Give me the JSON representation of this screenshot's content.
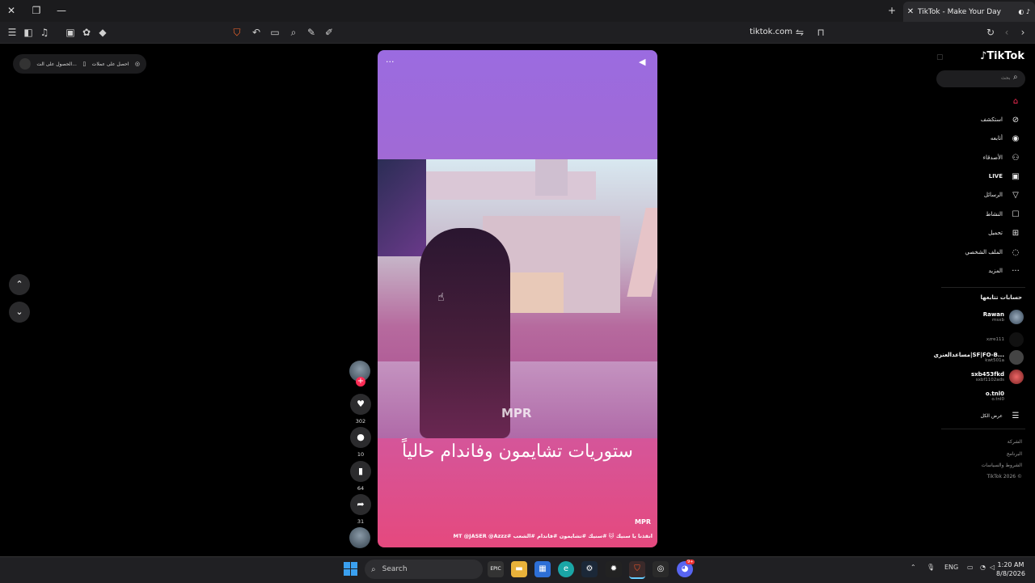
{
  "browser": {
    "tab_title": "TikTok - Make Your Day",
    "url": "tiktok.com"
  },
  "promo": {
    "item1": "احصل على عملات",
    "item2": "الحصول على الت..."
  },
  "video": {
    "watermark": "MPR",
    "caption": "ستوريات تشايمون وفاندام حالياً",
    "author_tag": "MPR",
    "description": "انقذنا يا سنيك 🐱 #سنيك #تشايمون #فاندام #الشعب #MT @JASER @Azzz"
  },
  "actions": {
    "likes": "302",
    "comments": "10",
    "saves": "64",
    "shares": "31"
  },
  "sidebar": {
    "logo": "TikTok",
    "search_placeholder": "بحث",
    "nav": [
      {
        "label": "",
        "icon": "home-icon"
      },
      {
        "label": "استكشف",
        "icon": "compass-icon"
      },
      {
        "label": "أتابعه",
        "icon": "following-icon"
      },
      {
        "label": "الأصدقاء",
        "icon": "friends-icon"
      },
      {
        "label": "LIVE",
        "icon": "live-icon"
      },
      {
        "label": "الرسائل",
        "icon": "messages-icon"
      },
      {
        "label": "النشاط",
        "icon": "activity-icon"
      },
      {
        "label": "تحميل",
        "icon": "upload-icon"
      },
      {
        "label": "الملف الشخصي",
        "icon": "profile-icon"
      },
      {
        "label": "المزيد",
        "icon": "more-icon"
      }
    ],
    "following_title": "حسابات تتابعها",
    "accounts": [
      {
        "name": "Rawan",
        "handle": "msxb"
      },
      {
        "name": "",
        "handle": "xzre111"
      },
      {
        "name": "مساعدالعنزي|SF|FO-B...",
        "handle": "kwt501a"
      },
      {
        "name": "sxb453fkd",
        "handle": "sxbf1102ads"
      },
      {
        "name": "o.tnl0",
        "handle": "o.tnl0"
      }
    ],
    "see_all": "عرض الكل",
    "footer": [
      "الشركة",
      "البرنامج",
      "الشروط والسياسات",
      "TikTok 2026 ©"
    ]
  },
  "taskbar": {
    "search": "Search",
    "lang": "ENG",
    "time": "1:20 AM",
    "date": "8/8/2026",
    "discord_badge": "9+"
  }
}
